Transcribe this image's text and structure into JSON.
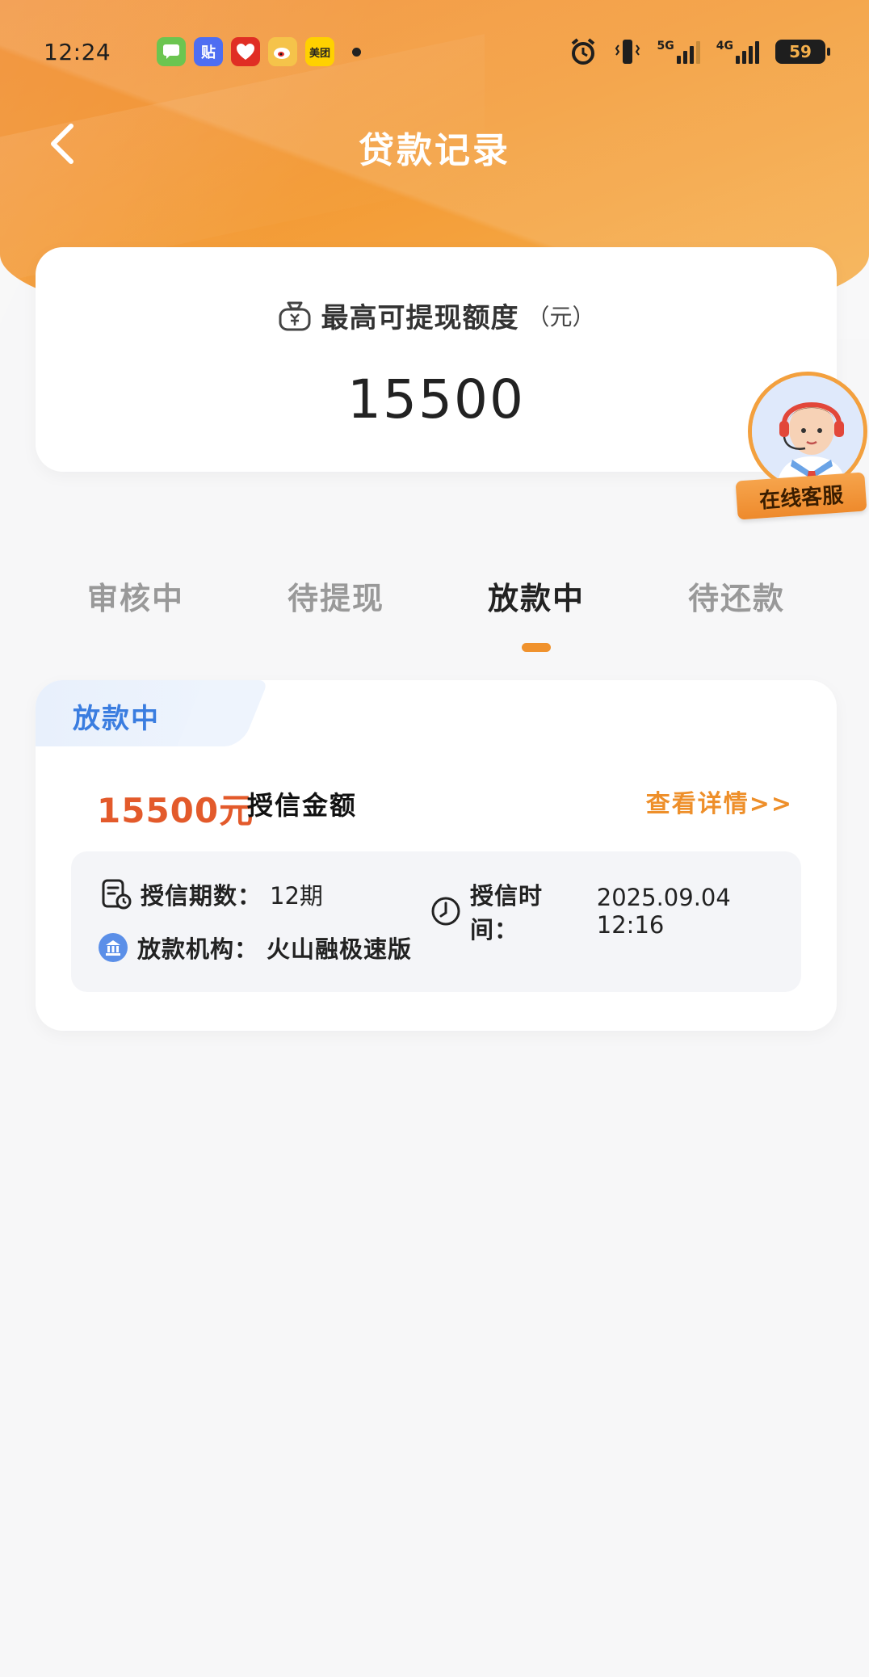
{
  "status_bar": {
    "time": "12:24",
    "notification_apps": [
      {
        "icon": "message-app-icon",
        "glyph": "",
        "color": "#6cc550"
      },
      {
        "icon": "tieba-app-icon",
        "glyph": "贴",
        "color": "#4e6ef2"
      },
      {
        "icon": "pinduoduo-app-icon",
        "glyph": "",
        "color": "#e02e24"
      },
      {
        "icon": "weibo-app-icon",
        "glyph": "",
        "color": "#f5c34a"
      },
      {
        "icon": "meituan-app-icon",
        "glyph": "美团",
        "color": "#ffd100"
      }
    ],
    "signal_1": "5G",
    "signal_2": "4G",
    "battery": "59"
  },
  "nav": {
    "title": "贷款记录"
  },
  "quota": {
    "label": "最高可提现额度",
    "unit": "（元）",
    "value": "15500"
  },
  "customer_service": {
    "label": "在线客服"
  },
  "tabs": [
    {
      "label": "审核中",
      "active": false
    },
    {
      "label": "待提现",
      "active": false
    },
    {
      "label": "放款中",
      "active": true
    },
    {
      "label": "待还款",
      "active": false
    }
  ],
  "record": {
    "status_tag": "放款中",
    "amount": "15500元",
    "amount_label": "授信金额",
    "detail_link": "查看详情>>",
    "periods_label": "授信期数：",
    "periods_value": "12期",
    "time_label": "授信时间：",
    "time_value": "2025.09.04  12:16",
    "institution_label": "放款机构：",
    "institution_value": "火山融极速版"
  },
  "colors": {
    "accent_orange": "#f0922d",
    "amount_red": "#e35a2b",
    "tag_blue": "#3a7de0"
  }
}
